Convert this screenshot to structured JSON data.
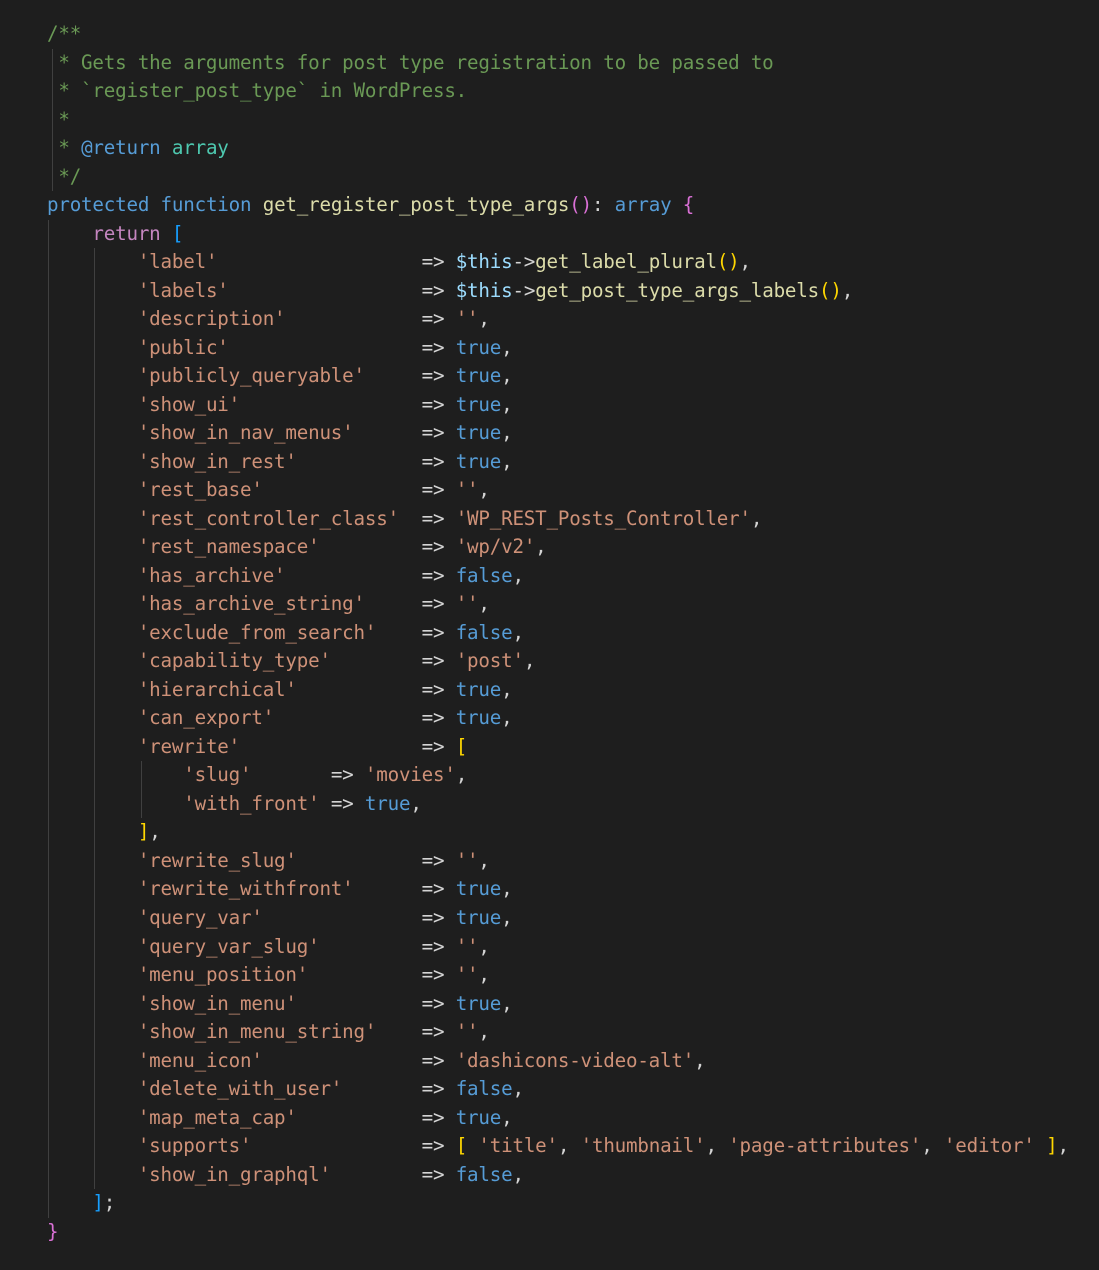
{
  "editor": {
    "language": "php",
    "theme": "dark",
    "colors": {
      "background": "#1e1e1e",
      "comment": "#6a9955",
      "keyword": "#569cd6",
      "control": "#c586c0",
      "function": "#dcdcaa",
      "string": "#ce9178",
      "variable": "#9cdcfe",
      "text": "#d4d4d4",
      "bracket_level1": "#ffd700",
      "bracket_level2": "#da70d6",
      "bracket_level3": "#179fff"
    },
    "lines": [
      {
        "indent": 0,
        "tokens": [
          [
            "comment",
            "/**"
          ]
        ]
      },
      {
        "indent": 0,
        "tokens": [
          [
            "comment",
            " * Gets the arguments for post type registration to be passed to"
          ]
        ]
      },
      {
        "indent": 0,
        "tokens": [
          [
            "comment",
            " * `register_post_type` in WordPress."
          ]
        ]
      },
      {
        "indent": 0,
        "tokens": [
          [
            "comment",
            " *"
          ]
        ]
      },
      {
        "indent": 0,
        "tokens": [
          [
            "comment",
            " * "
          ],
          [
            "doctag",
            "@return"
          ],
          [
            "comment",
            " "
          ],
          [
            "doctype",
            "array"
          ]
        ]
      },
      {
        "indent": 0,
        "tokens": [
          [
            "comment",
            " */"
          ]
        ]
      },
      {
        "indent": 0,
        "tokens": [
          [
            "modifier",
            "protected"
          ],
          [
            "op",
            " "
          ],
          [
            "keyword",
            "function"
          ],
          [
            "op",
            " "
          ],
          [
            "func",
            "get_register_post_type_args"
          ],
          [
            "b2",
            "()"
          ],
          [
            "op",
            ": "
          ],
          [
            "type",
            "array"
          ],
          [
            "op",
            " "
          ],
          [
            "b2",
            "{"
          ]
        ]
      },
      {
        "indent": 1,
        "tokens": [
          [
            "return",
            "return"
          ],
          [
            "op",
            " "
          ],
          [
            "b3",
            "["
          ]
        ]
      },
      {
        "indent": 2,
        "tokens": [
          [
            "string",
            "'label'"
          ],
          [
            "op",
            "                  => "
          ],
          [
            "var",
            "$this"
          ],
          [
            "op",
            "->"
          ],
          [
            "func",
            "get_label_plural"
          ],
          [
            "b1",
            "()"
          ],
          [
            "punct",
            ","
          ]
        ]
      },
      {
        "indent": 2,
        "tokens": [
          [
            "string",
            "'labels'"
          ],
          [
            "op",
            "                 => "
          ],
          [
            "var",
            "$this"
          ],
          [
            "op",
            "->"
          ],
          [
            "func",
            "get_post_type_args_labels"
          ],
          [
            "b1",
            "()"
          ],
          [
            "punct",
            ","
          ]
        ]
      },
      {
        "indent": 2,
        "tokens": [
          [
            "string",
            "'description'"
          ],
          [
            "op",
            "            => "
          ],
          [
            "string",
            "''"
          ],
          [
            "punct",
            ","
          ]
        ]
      },
      {
        "indent": 2,
        "tokens": [
          [
            "string",
            "'public'"
          ],
          [
            "op",
            "                 => "
          ],
          [
            "bool",
            "true"
          ],
          [
            "punct",
            ","
          ]
        ]
      },
      {
        "indent": 2,
        "tokens": [
          [
            "string",
            "'publicly_queryable'"
          ],
          [
            "op",
            "     => "
          ],
          [
            "bool",
            "true"
          ],
          [
            "punct",
            ","
          ]
        ]
      },
      {
        "indent": 2,
        "tokens": [
          [
            "string",
            "'show_ui'"
          ],
          [
            "op",
            "                => "
          ],
          [
            "bool",
            "true"
          ],
          [
            "punct",
            ","
          ]
        ]
      },
      {
        "indent": 2,
        "tokens": [
          [
            "string",
            "'show_in_nav_menus'"
          ],
          [
            "op",
            "      => "
          ],
          [
            "bool",
            "true"
          ],
          [
            "punct",
            ","
          ]
        ]
      },
      {
        "indent": 2,
        "tokens": [
          [
            "string",
            "'show_in_rest'"
          ],
          [
            "op",
            "           => "
          ],
          [
            "bool",
            "true"
          ],
          [
            "punct",
            ","
          ]
        ]
      },
      {
        "indent": 2,
        "tokens": [
          [
            "string",
            "'rest_base'"
          ],
          [
            "op",
            "              => "
          ],
          [
            "string",
            "''"
          ],
          [
            "punct",
            ","
          ]
        ]
      },
      {
        "indent": 2,
        "tokens": [
          [
            "string",
            "'rest_controller_class'"
          ],
          [
            "op",
            "  => "
          ],
          [
            "string",
            "'WP_REST_Posts_Controller'"
          ],
          [
            "punct",
            ","
          ]
        ]
      },
      {
        "indent": 2,
        "tokens": [
          [
            "string",
            "'rest_namespace'"
          ],
          [
            "op",
            "         => "
          ],
          [
            "string",
            "'wp/v2'"
          ],
          [
            "punct",
            ","
          ]
        ]
      },
      {
        "indent": 2,
        "tokens": [
          [
            "string",
            "'has_archive'"
          ],
          [
            "op",
            "            => "
          ],
          [
            "bool",
            "false"
          ],
          [
            "punct",
            ","
          ]
        ]
      },
      {
        "indent": 2,
        "tokens": [
          [
            "string",
            "'has_archive_string'"
          ],
          [
            "op",
            "     => "
          ],
          [
            "string",
            "''"
          ],
          [
            "punct",
            ","
          ]
        ]
      },
      {
        "indent": 2,
        "tokens": [
          [
            "string",
            "'exclude_from_search'"
          ],
          [
            "op",
            "    => "
          ],
          [
            "bool",
            "false"
          ],
          [
            "punct",
            ","
          ]
        ]
      },
      {
        "indent": 2,
        "tokens": [
          [
            "string",
            "'capability_type'"
          ],
          [
            "op",
            "        => "
          ],
          [
            "string",
            "'post'"
          ],
          [
            "punct",
            ","
          ]
        ]
      },
      {
        "indent": 2,
        "tokens": [
          [
            "string",
            "'hierarchical'"
          ],
          [
            "op",
            "           => "
          ],
          [
            "bool",
            "true"
          ],
          [
            "punct",
            ","
          ]
        ]
      },
      {
        "indent": 2,
        "tokens": [
          [
            "string",
            "'can_export'"
          ],
          [
            "op",
            "             => "
          ],
          [
            "bool",
            "true"
          ],
          [
            "punct",
            ","
          ]
        ]
      },
      {
        "indent": 2,
        "tokens": [
          [
            "string",
            "'rewrite'"
          ],
          [
            "op",
            "                => "
          ],
          [
            "b1",
            "["
          ]
        ]
      },
      {
        "indent": 3,
        "tokens": [
          [
            "string",
            "'slug'"
          ],
          [
            "op",
            "       => "
          ],
          [
            "string",
            "'movies'"
          ],
          [
            "punct",
            ","
          ]
        ]
      },
      {
        "indent": 3,
        "tokens": [
          [
            "string",
            "'with_front'"
          ],
          [
            "op",
            " => "
          ],
          [
            "bool",
            "true"
          ],
          [
            "punct",
            ","
          ]
        ]
      },
      {
        "indent": 2,
        "tokens": [
          [
            "b1",
            "]"
          ],
          [
            "punct",
            ","
          ]
        ]
      },
      {
        "indent": 2,
        "tokens": [
          [
            "string",
            "'rewrite_slug'"
          ],
          [
            "op",
            "           => "
          ],
          [
            "string",
            "''"
          ],
          [
            "punct",
            ","
          ]
        ]
      },
      {
        "indent": 2,
        "tokens": [
          [
            "string",
            "'rewrite_withfront'"
          ],
          [
            "op",
            "      => "
          ],
          [
            "bool",
            "true"
          ],
          [
            "punct",
            ","
          ]
        ]
      },
      {
        "indent": 2,
        "tokens": [
          [
            "string",
            "'query_var'"
          ],
          [
            "op",
            "              => "
          ],
          [
            "bool",
            "true"
          ],
          [
            "punct",
            ","
          ]
        ]
      },
      {
        "indent": 2,
        "tokens": [
          [
            "string",
            "'query_var_slug'"
          ],
          [
            "op",
            "         => "
          ],
          [
            "string",
            "''"
          ],
          [
            "punct",
            ","
          ]
        ]
      },
      {
        "indent": 2,
        "tokens": [
          [
            "string",
            "'menu_position'"
          ],
          [
            "op",
            "          => "
          ],
          [
            "string",
            "''"
          ],
          [
            "punct",
            ","
          ]
        ]
      },
      {
        "indent": 2,
        "tokens": [
          [
            "string",
            "'show_in_menu'"
          ],
          [
            "op",
            "           => "
          ],
          [
            "bool",
            "true"
          ],
          [
            "punct",
            ","
          ]
        ]
      },
      {
        "indent": 2,
        "tokens": [
          [
            "string",
            "'show_in_menu_string'"
          ],
          [
            "op",
            "    => "
          ],
          [
            "string",
            "''"
          ],
          [
            "punct",
            ","
          ]
        ]
      },
      {
        "indent": 2,
        "tokens": [
          [
            "string",
            "'menu_icon'"
          ],
          [
            "op",
            "              => "
          ],
          [
            "string",
            "'dashicons-video-alt'"
          ],
          [
            "punct",
            ","
          ]
        ]
      },
      {
        "indent": 2,
        "tokens": [
          [
            "string",
            "'delete_with_user'"
          ],
          [
            "op",
            "       => "
          ],
          [
            "bool",
            "false"
          ],
          [
            "punct",
            ","
          ]
        ]
      },
      {
        "indent": 2,
        "tokens": [
          [
            "string",
            "'map_meta_cap'"
          ],
          [
            "op",
            "           => "
          ],
          [
            "bool",
            "true"
          ],
          [
            "punct",
            ","
          ]
        ]
      },
      {
        "indent": 2,
        "tokens": [
          [
            "string",
            "'supports'"
          ],
          [
            "op",
            "               => "
          ],
          [
            "b1",
            "["
          ],
          [
            "op",
            " "
          ],
          [
            "string",
            "'title'"
          ],
          [
            "punct",
            ", "
          ],
          [
            "string",
            "'thumbnail'"
          ],
          [
            "punct",
            ", "
          ],
          [
            "string",
            "'page-attributes'"
          ],
          [
            "punct",
            ", "
          ],
          [
            "string",
            "'editor'"
          ],
          [
            "op",
            " "
          ],
          [
            "b1",
            "]"
          ],
          [
            "punct",
            ","
          ]
        ]
      },
      {
        "indent": 2,
        "tokens": [
          [
            "string",
            "'show_in_graphql'"
          ],
          [
            "op",
            "        => "
          ],
          [
            "bool",
            "false"
          ],
          [
            "punct",
            ","
          ]
        ]
      },
      {
        "indent": 1,
        "tokens": [
          [
            "b3",
            "]"
          ],
          [
            "punct",
            ";"
          ]
        ]
      },
      {
        "indent": 0,
        "tokens": [
          [
            "b2",
            "}"
          ]
        ]
      }
    ]
  }
}
